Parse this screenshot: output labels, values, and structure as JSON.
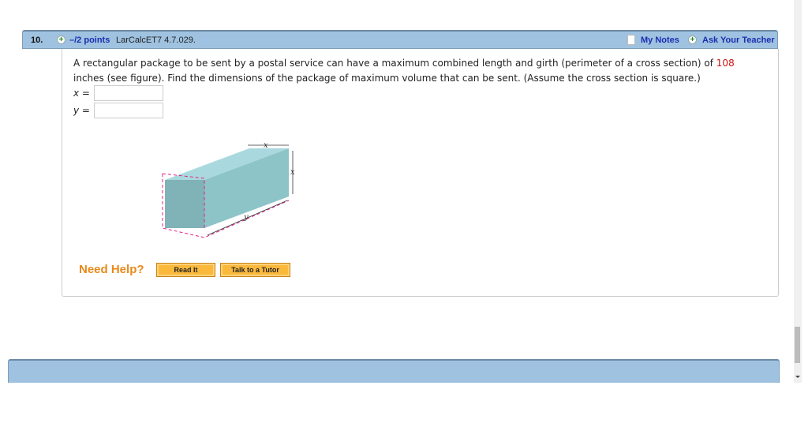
{
  "question": {
    "number": "10.",
    "points": "–/2 points",
    "code": "LarCalcET7 4.7.029.",
    "my_notes": "My Notes",
    "ask_teacher": "Ask Your Teacher",
    "text_before": "A rectangular package to be sent by a postal service can have a maximum combined length and girth (perimeter of a cross section) of ",
    "highlight_value": "108",
    "text_after": " inches (see figure). Find the dimensions of the package of maximum volume that can be sent. (Assume the cross section is square.)",
    "answers": [
      {
        "label": "x =",
        "value": ""
      },
      {
        "label": "y =",
        "value": ""
      }
    ],
    "figure": {
      "labels": {
        "top_width": "x",
        "side_height": "x",
        "length": "y"
      },
      "colors": {
        "box_front": "#7fb3b8",
        "box_top": "#a9d9de",
        "box_side": "#8cc4c8",
        "girth_dash": "#e0208a"
      }
    }
  },
  "help": {
    "title": "Need Help?",
    "buttons": [
      "Read It",
      "Talk to a Tutor"
    ]
  },
  "colors": {
    "header_bg": "#9fc2e0",
    "link": "#1a2fb0",
    "highlight": "#d01010",
    "help_orange": "#e8891a",
    "button_bg": "#fbb93c"
  }
}
